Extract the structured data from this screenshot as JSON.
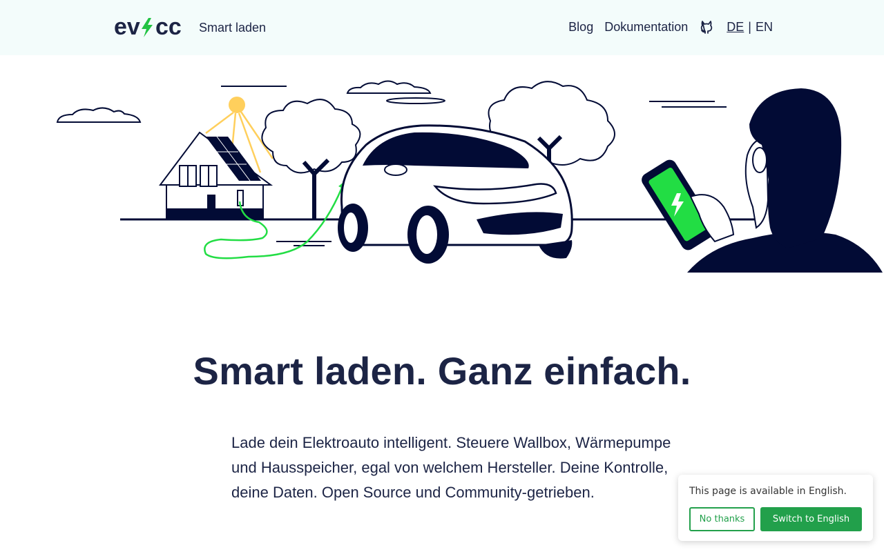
{
  "header": {
    "tagline": "Smart laden",
    "nav": {
      "blog": "Blog",
      "docs": "Dokumentation",
      "github_icon": "github-icon",
      "lang_de": "DE",
      "lang_sep": "|",
      "lang_en": "EN"
    }
  },
  "logo": {
    "text_left": "ev",
    "text_right": "cc",
    "bolt_color": "#22c343",
    "text_color": "#1c2445"
  },
  "hero": {
    "illustration": "illustration-ev-charging",
    "accent_green": "#22dd44",
    "sun_color": "#ffcf5c",
    "ink_color": "#020b35"
  },
  "main": {
    "headline": "Smart laden. Ganz einfach.",
    "intro": "Lade dein Elektroauto intelligent. Steuere Wallbox, Wärmepumpe und Hausspeicher, egal von welchem Hersteller. Deine Kontrolle, deine Daten. Open Source und Community-getrieben."
  },
  "language_popup": {
    "message": "This page is available in English.",
    "no_thanks": "No thanks",
    "switch": "Switch to English",
    "accent": "#22a04b"
  }
}
